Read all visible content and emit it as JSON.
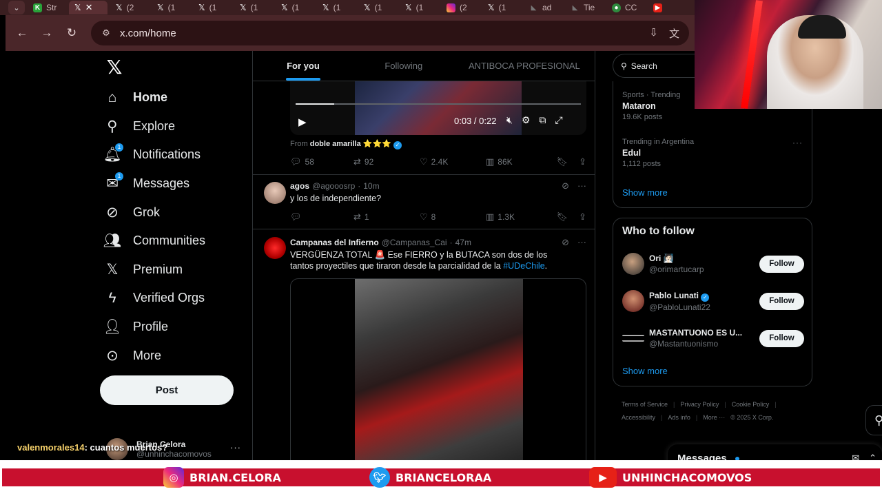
{
  "browser": {
    "tabs": [
      {
        "label": "Str",
        "icon": "kick-icon"
      },
      {
        "label": "",
        "icon": "x-icon",
        "active": true
      },
      {
        "label": "(2",
        "icon": "x-icon"
      },
      {
        "label": "(1",
        "icon": "x-icon"
      },
      {
        "label": "(1",
        "icon": "x-icon"
      },
      {
        "label": "(1",
        "icon": "x-icon"
      },
      {
        "label": "(1",
        "icon": "x-icon"
      },
      {
        "label": "(1",
        "icon": "x-icon"
      },
      {
        "label": "(1",
        "icon": "x-icon"
      },
      {
        "label": "(1",
        "icon": "x-icon"
      },
      {
        "label": "(2",
        "icon": "instagram-icon"
      },
      {
        "label": "(1",
        "icon": "x-icon"
      },
      {
        "label": "ad",
        "icon": "brand-icon"
      },
      {
        "label": "Tie",
        "icon": "brand-icon"
      },
      {
        "label": "CC",
        "icon": "football-icon"
      },
      {
        "label": "",
        "icon": "youtube-icon"
      }
    ],
    "url": "x.com/home"
  },
  "nav": {
    "items": [
      {
        "label": "Home",
        "icon": "home-icon"
      },
      {
        "label": "Explore",
        "icon": "search-icon"
      },
      {
        "label": "Notifications",
        "icon": "bell-icon",
        "badge": "1"
      },
      {
        "label": "Messages",
        "icon": "mail-icon",
        "badge": "1"
      },
      {
        "label": "Grok",
        "icon": "grok-icon"
      },
      {
        "label": "Communities",
        "icon": "communities-icon"
      },
      {
        "label": "Premium",
        "icon": "x-icon"
      },
      {
        "label": "Verified Orgs",
        "icon": "lightning-icon"
      },
      {
        "label": "Profile",
        "icon": "profile-icon"
      },
      {
        "label": "More",
        "icon": "more-circle-icon"
      }
    ],
    "post_label": "Post",
    "account": {
      "name": "Brian Celora",
      "handle": "@unhinchacomovos"
    }
  },
  "timeline": {
    "tabs": [
      "For you",
      "Following",
      "ANTIBOCA PROFESIONAL"
    ],
    "video": {
      "time": "0:03 / 0:22",
      "progress": 0.136
    },
    "from_prefix": "From",
    "from_name": "doble amarilla",
    "from_stars": "⭐⭐⭐",
    "tweet1_actions": {
      "replies": "58",
      "reposts": "92",
      "likes": "2.4K",
      "views": "86K"
    },
    "tweet2": {
      "name": "agos",
      "handle": "@agooosrp",
      "time": "10m",
      "text": "y los de independiente?",
      "replies": "",
      "reposts": "1",
      "likes": "8",
      "views": "1.3K"
    },
    "tweet3": {
      "name": "Campanas del Infierno",
      "handle": "@Campanas_Cai",
      "time": "47m",
      "text": "VERGÜENZA TOTAL 🚨 Ese FIERRO y la BUTACA son dos de los tantos proyectiles que tiraron desde la parcialidad de la ",
      "hashtag": "#UDeChile",
      "text_end": "."
    }
  },
  "right": {
    "search_placeholder": "Search",
    "trends": [
      {
        "meta": "Sports · Trending",
        "name": "Mataron",
        "count": "19.6K posts"
      },
      {
        "meta": "Trending in Argentina",
        "name": "Edul",
        "count": "1,112 posts"
      }
    ],
    "trends_show_more": "Show more",
    "who_to_follow_title": "Who to follow",
    "follow_suggestions": [
      {
        "name": "Ori 🧖🏻",
        "handle": "@orimartucarp",
        "button": "Follow"
      },
      {
        "name": "Pablo Lunati",
        "handle": "@PabloLunati22",
        "button": "Follow",
        "verified": true
      },
      {
        "name": "MASTANTUONO ES U...",
        "handle": "@Mastantuonismo",
        "button": "Follow"
      }
    ],
    "wtf_show_more": "Show more",
    "footer": [
      "Terms of Service",
      "Privacy Policy",
      "Cookie Policy",
      "Accessibility",
      "Ads info",
      "More ···",
      "© 2025 X Corp."
    ],
    "messages_title": "Messages"
  },
  "overlay": {
    "chat_user": "valenmorales14",
    "chat_text": ": cuantos muertos?",
    "socials": [
      {
        "icon": "instagram-icon",
        "label": "BRIAN.CELORA"
      },
      {
        "icon": "twitter-icon",
        "label": "BRIANCELORAA"
      },
      {
        "icon": "youtube-icon",
        "label": "UNHINCHACOMOVOS"
      }
    ]
  },
  "colors": {
    "accent": "#1d9bf0",
    "browser_frame": "#4a2629",
    "banner_red": "#c8102e"
  }
}
